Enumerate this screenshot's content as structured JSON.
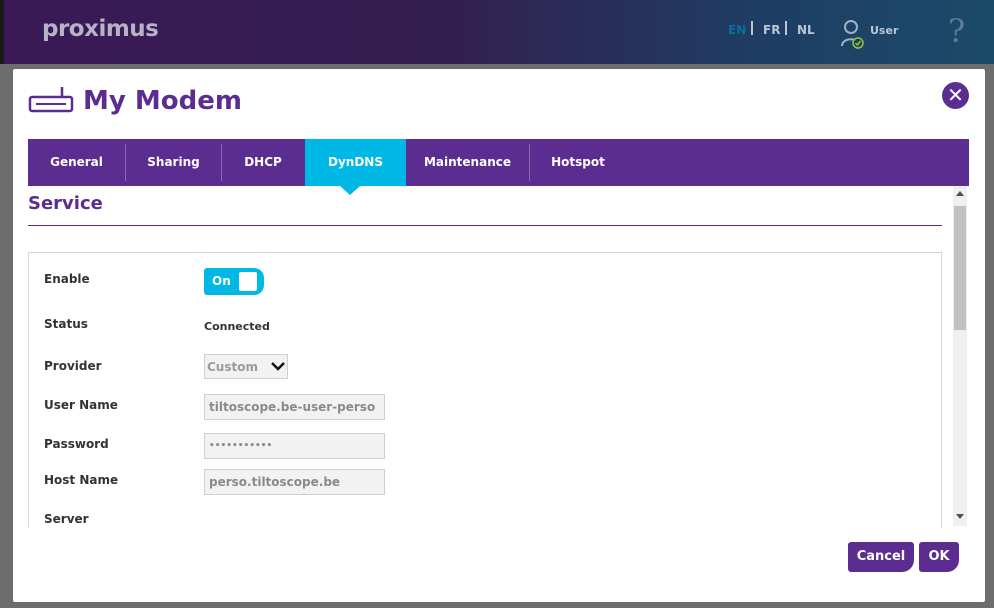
{
  "header": {
    "logo": "proximus",
    "languages": [
      {
        "code": "EN",
        "active": true
      },
      {
        "code": "FR",
        "active": false
      },
      {
        "code": "NL",
        "active": false
      }
    ],
    "user_label": "User",
    "help_icon": "?"
  },
  "modal": {
    "title": "My Modem",
    "close_icon": "✕",
    "tabs": [
      {
        "label": "General"
      },
      {
        "label": "Sharing"
      },
      {
        "label": "DHCP"
      },
      {
        "label": "DynDNS",
        "active": true
      },
      {
        "label": "Maintenance"
      },
      {
        "label": "Hotspot"
      }
    ],
    "section_title": "Service",
    "form": {
      "enable_label": "Enable",
      "enable_value": "On",
      "status_label": "Status",
      "status_value": "Connected",
      "provider_label": "Provider",
      "provider_value": "Custom",
      "username_label": "User Name",
      "username_value": "tiltoscope.be-user-perso",
      "password_label": "Password",
      "password_value": "•••••••••••",
      "hostname_label": "Host Name",
      "hostname_value": "perso.tiltoscope.be",
      "server_label": "Server"
    },
    "buttons": {
      "cancel": "Cancel",
      "ok": "OK"
    }
  },
  "colors": {
    "brand_purple": "#5c2d91",
    "accent_cyan": "#00b8e6"
  }
}
